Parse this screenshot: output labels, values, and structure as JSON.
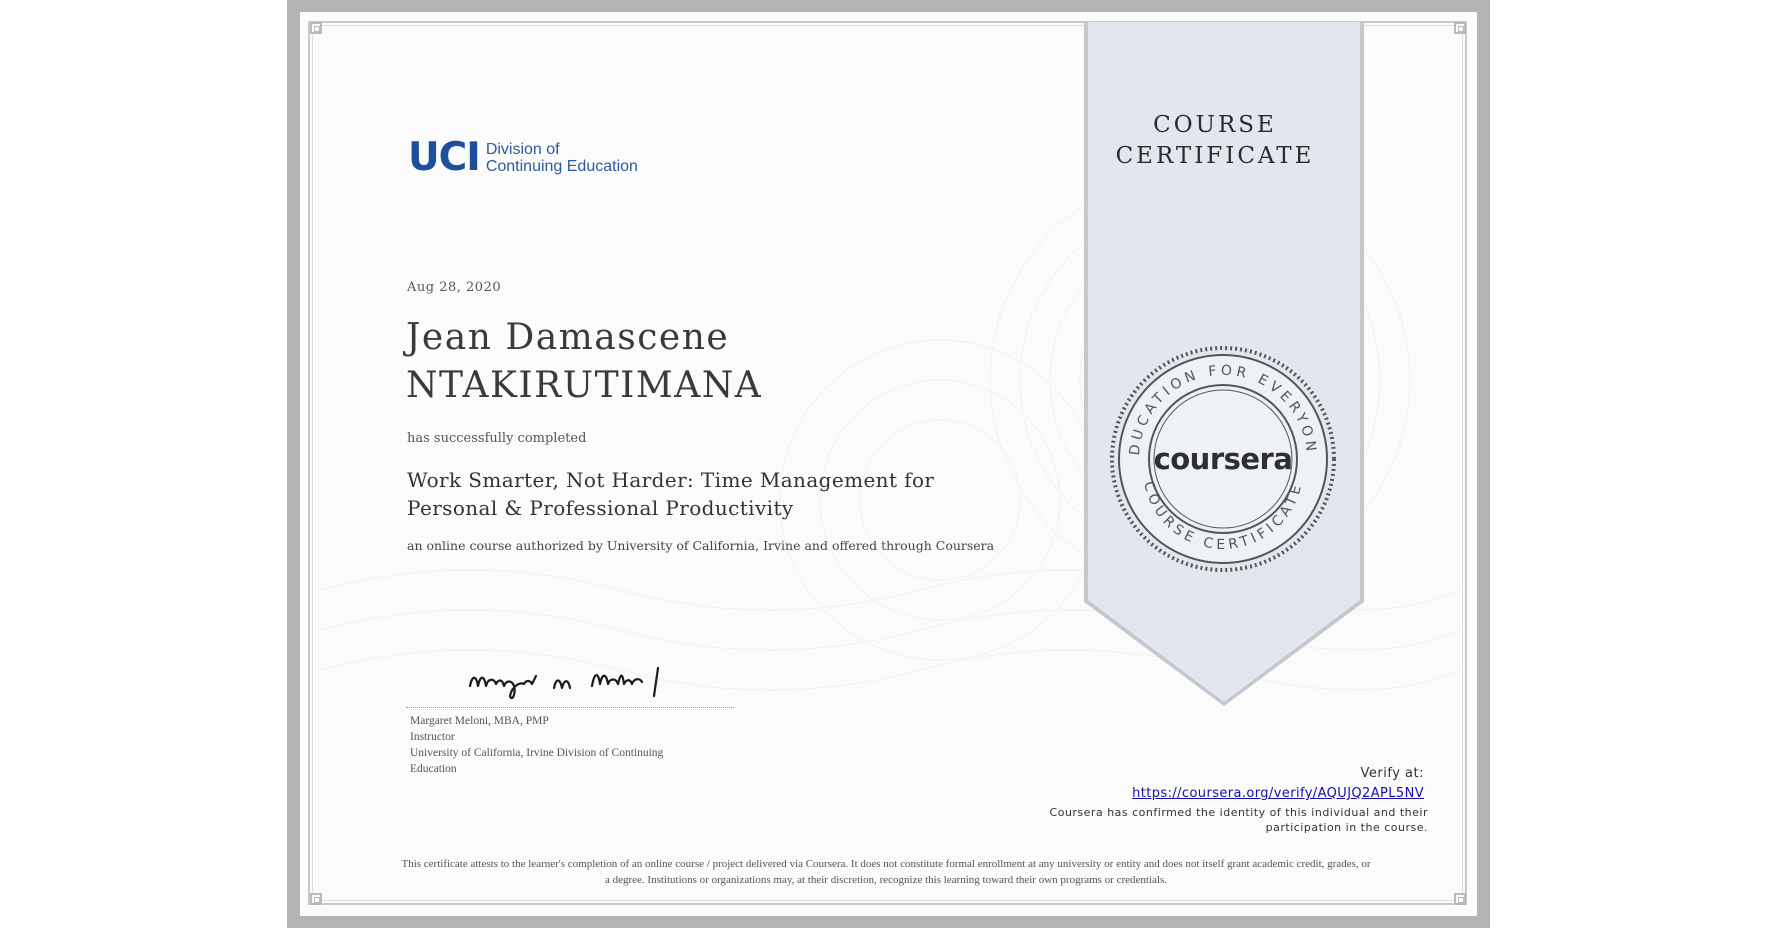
{
  "certificate": {
    "ribbon_title_line1": "COURSE",
    "ribbon_title_line2": "CERTIFICATE",
    "issuer_logo": {
      "mark": "UCI",
      "line1": "Division of",
      "line2": "Continuing Education"
    },
    "date": "Aug 28, 2020",
    "recipient_line1": "Jean Damascene",
    "recipient_line2": "NTAKIRUTIMANA",
    "completed_text": "has successfully completed",
    "course_line1": "Work Smarter, Not Harder: Time Management for",
    "course_line2": "Personal & Professional Productivity",
    "offered_text": "an online course authorized by University of California, Irvine and offered through Coursera",
    "signature_text": "Margaret M Meloni",
    "instructor": {
      "name": "Margaret Meloni, MBA, PMP",
      "role": "Instructor",
      "org_line1": "University of California, Irvine Division of Continuing",
      "org_line2": "Education"
    },
    "seal": {
      "brand": "coursera",
      "ring_top": "EDUCATION FOR EVERYONE",
      "ring_bottom": "COURSE CERTIFICATE"
    },
    "verify_label": "Verify at:",
    "verify_url": "https://coursera.org/verify/AQUJQ2APL5NV",
    "verify_note_line1": "Coursera has confirmed the identity of this individual and their",
    "verify_note_line2": "participation in the course.",
    "disclaimer_line1": "This certificate attests to the learner's completion of an online course / project delivered via Coursera. It does not constitute formal enrollment at any university or entity and does not itself grant academic credit, grades, or",
    "disclaimer_line2": "a degree. Institutions or organizations may, at their discretion, recognize this learning toward their own programs or credentials."
  },
  "colors": {
    "frame": "#b3b3b3",
    "ribbon": "#e2e7ef",
    "uci_blue": "#1e4f9a",
    "link": "#1a0dab",
    "seal": "#555555"
  }
}
